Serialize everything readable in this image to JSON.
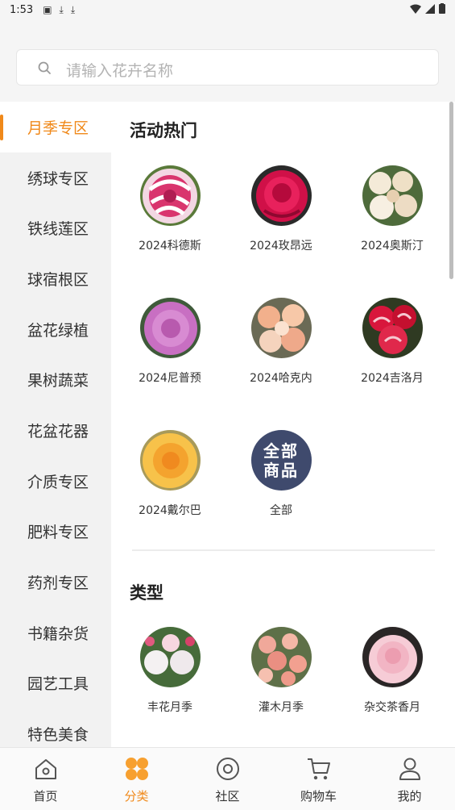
{
  "status_bar": {
    "time": "1:53"
  },
  "search": {
    "placeholder": "请输入花卉名称"
  },
  "sidebar": {
    "items": [
      {
        "label": "月季专区",
        "active": true
      },
      {
        "label": "绣球专区"
      },
      {
        "label": "铁线莲区"
      },
      {
        "label": "球宿根区"
      },
      {
        "label": "盆花绿植"
      },
      {
        "label": "果树蔬菜"
      },
      {
        "label": "花盆花器"
      },
      {
        "label": "介质专区"
      },
      {
        "label": "肥料专区"
      },
      {
        "label": "药剂专区"
      },
      {
        "label": "书籍杂货"
      },
      {
        "label": "园艺工具"
      },
      {
        "label": "特色美食"
      }
    ]
  },
  "hot": {
    "title": "活动热门",
    "items": [
      {
        "label": "2024科德斯",
        "icon": "rose-pink-white-striped"
      },
      {
        "label": "2024玫昂远",
        "icon": "rose-magenta"
      },
      {
        "label": "2024奥斯汀",
        "icon": "rose-cream"
      },
      {
        "label": "2024尼普预",
        "icon": "rose-lilac"
      },
      {
        "label": "2024哈克内",
        "icon": "rose-peach"
      },
      {
        "label": "2024吉洛月",
        "icon": "rose-red-striped"
      },
      {
        "label": "2024戴尔巴",
        "icon": "rose-yellow-orange"
      },
      {
        "label": "全部",
        "badge_line1": "全部",
        "badge_line2": "商品"
      }
    ]
  },
  "types": {
    "title": "类型",
    "items": [
      {
        "label": "丰花月季",
        "icon": "rose-white-cluster"
      },
      {
        "label": "灌木月季",
        "icon": "rose-pink-shrub"
      },
      {
        "label": "杂交茶香月",
        "icon": "rose-soft-pink"
      }
    ]
  },
  "tabbar": {
    "items": [
      {
        "label": "首页",
        "icon": "home-icon"
      },
      {
        "label": "分类",
        "icon": "category-icon",
        "active": true
      },
      {
        "label": "社区",
        "icon": "community-icon"
      },
      {
        "label": "购物车",
        "icon": "cart-icon"
      },
      {
        "label": "我的",
        "icon": "profile-icon"
      }
    ]
  },
  "colors": {
    "accent": "#f0891a",
    "badge": "#3f4a6d"
  }
}
